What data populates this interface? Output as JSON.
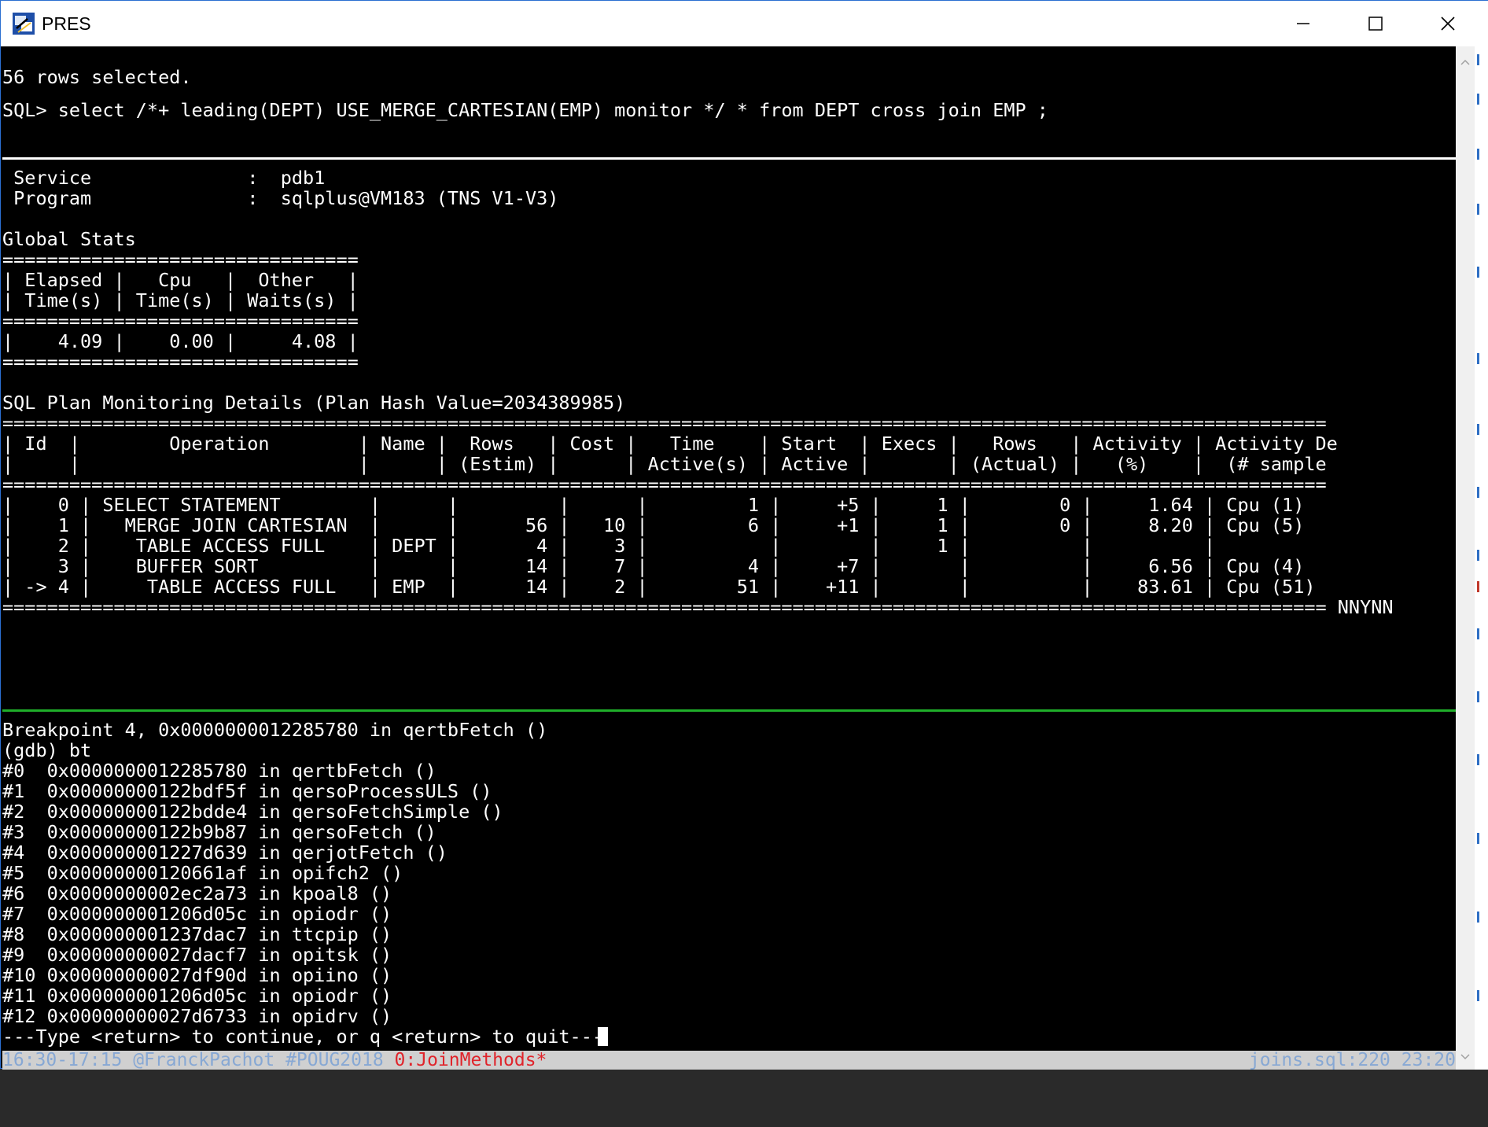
{
  "window": {
    "title": "PRES",
    "minimize_icon": "minimize-icon",
    "maximize_icon": "maximize-icon",
    "close_icon": "close-icon"
  },
  "upper_pane": {
    "lines": [
      "56 rows selected.",
      "SQL> select /*+ leading(DEPT) USE_MERGE_CARTESIAN(EMP) monitor */ * from DEPT cross join EMP ;"
    ]
  },
  "monitor_pane": {
    "lines": [
      " Service              :  pdb1",
      " Program              :  sqlplus@VM183 (TNS V1-V3)",
      "",
      "Global Stats",
      "================================",
      "| Elapsed |   Cpu   |  Other   |",
      "| Time(s) | Time(s) | Waits(s) |",
      "================================",
      "|    4.09 |    0.00 |     4.08 |",
      "================================",
      "",
      "SQL Plan Monitoring Details (Plan Hash Value=2034389985)",
      "=======================================================================================================================",
      "| Id  |        Operation        | Name |  Rows   | Cost |   Time    | Start  | Execs |   Rows   | Activity | Activity De",
      "|     |                         |      | (Estim) |      | Active(s) | Active |       | (Actual) |   (%)    |  (# sample",
      "=======================================================================================================================",
      "|    0 | SELECT STATEMENT        |      |         |      |         1 |     +5 |     1 |        0 |     1.64 | Cpu (1)",
      "|    1 |   MERGE JOIN CARTESIAN  |      |      56 |   10 |         6 |     +1 |     1 |        0 |     8.20 | Cpu (5)",
      "|    2 |    TABLE ACCESS FULL    | DEPT |       4 |    3 |           |        |     1 |          |          |",
      "|    3 |    BUFFER SORT          |      |      14 |    7 |         4 |     +7 |       |          |     6.56 | Cpu (4)",
      "| -> 4 |     TABLE ACCESS FULL   | EMP  |      14 |    2 |        51 |    +11 |       |          |    83.61 | Cpu (51)",
      "======================================================================================================================= NNYNN"
    ]
  },
  "gdb_pane": {
    "lines": [
      "Breakpoint 4, 0x0000000012285780 in qertbFetch ()",
      "(gdb) bt",
      "#0  0x0000000012285780 in qertbFetch ()",
      "#1  0x00000000122bdf5f in qersoProcessULS ()",
      "#2  0x00000000122bdde4 in qersoFetchSimple ()",
      "#3  0x00000000122b9b87 in qersoFetch ()",
      "#4  0x000000001227d639 in qerjotFetch ()",
      "#5  0x00000000120661af in opifch2 ()",
      "#6  0x0000000002ec2a73 in kpoal8 ()",
      "#7  0x000000001206d05c in opiodr ()",
      "#8  0x000000001237dac7 in ttcpip ()",
      "#9  0x00000000027dacf7 in opitsk ()",
      "#10 0x00000000027df90d in opiino ()",
      "#11 0x000000001206d05c in opiodr ()",
      "#12 0x00000000027d6733 in opidrv ()",
      "---Type <return> to continue, or q <return> to quit---"
    ]
  },
  "status_bar": {
    "time_range": "16:30-17:15",
    "handle": "@FranckPachot",
    "hashtag": "#POUG2018",
    "window_name": "0:JoinMethods*",
    "right": "joins.sql:220 23:20"
  },
  "colors": {
    "terminal_bg": "#000000",
    "terminal_fg": "#ffffff",
    "pane_separator_active": "#1fae2a",
    "status_bar_bg": "#d0d0d0",
    "status_blue": "#87a8d4",
    "status_red": "#e0242b"
  }
}
